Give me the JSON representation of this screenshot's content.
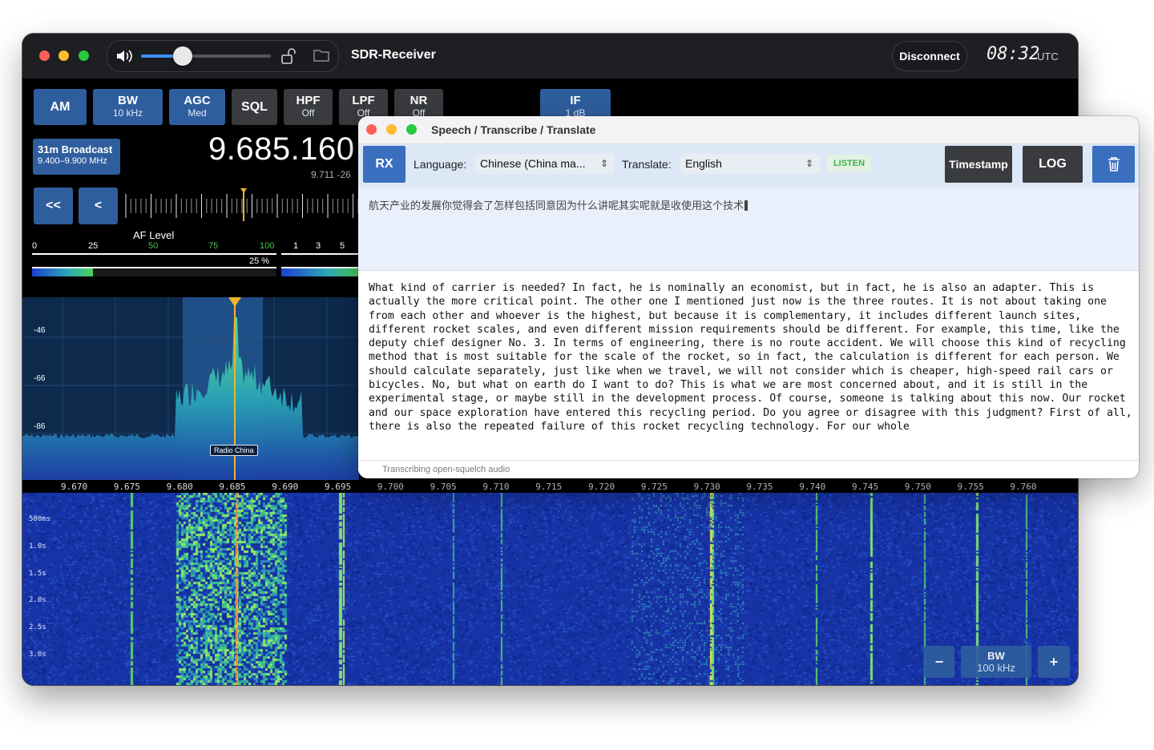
{
  "main_window": {
    "title": "SDR-Receiver",
    "disconnect_label": "Disconnect",
    "time": "08:32",
    "time_zone": "UTC",
    "volume_level": 0.32
  },
  "controls": {
    "am": "AM",
    "bw": {
      "label": "BW",
      "value": "10 kHz"
    },
    "agc": {
      "label": "AGC",
      "value": "Med"
    },
    "sql": "SQL",
    "hpf": {
      "label": "HPF",
      "value": "Off"
    },
    "lpf": {
      "label": "LPF",
      "value": "Off"
    },
    "nr": {
      "label": "NR",
      "value": "Off"
    },
    "if": {
      "label": "IF",
      "value": "1 dB"
    }
  },
  "band": {
    "name": "31m Broadcast",
    "range": "9.400–9.900 MHz"
  },
  "frequency": {
    "main": "9.685.160",
    "sub": "9.711 -26"
  },
  "tuning": {
    "fast_back": "<<",
    "back": "<"
  },
  "af": {
    "label": "AF Level",
    "ticks": [
      "0",
      "25",
      "50",
      "75",
      "100"
    ],
    "value_text": "25 %",
    "level": 0.25
  },
  "second_meter": {
    "ticks": [
      "1",
      "3",
      "5"
    ]
  },
  "spectrum": {
    "db_labels": [
      "-46",
      "-66",
      "-86"
    ],
    "station_label": "Radio China"
  },
  "freq_axis": [
    "9.670",
    "9.675",
    "9.680",
    "9.685",
    "9.690",
    "9.695",
    "9.700",
    "9.705",
    "9.710",
    "9.715",
    "9.720",
    "9.725",
    "9.730",
    "9.735",
    "9.740",
    "9.745",
    "9.750",
    "9.755",
    "9.760"
  ],
  "waterfall": {
    "time_labels": [
      "500ms",
      "1.0s",
      "1.5s",
      "2.0s",
      "2.5s",
      "3.0s"
    ],
    "zoom_out": "−",
    "zoom_in": "+",
    "bw_label": "BW",
    "bw_value": "100 kHz"
  },
  "speech_window": {
    "title": "Speech / Transcribe / Translate",
    "rx": "RX",
    "language_label": "Language:",
    "language_value": "Chinese (China ma...",
    "translate_label": "Translate:",
    "translate_value": "English",
    "listen_badge": "LISTEN",
    "timestamp_button": "Timestamp",
    "log_button": "LOG",
    "original_text": "航天产业的发展你觉得会了怎样包括同意因为什么讲呢其实呢就是收使用这个技术",
    "translation_text": "What kind of carrier is needed? In fact, he is nominally an economist, but in fact, he is also an adapter. This is actually the more critical point. The other one I mentioned just now is the three routes. It is not about taking one from each other and whoever is the highest, but because it is complementary, it includes different launch sites, different rocket scales, and even different mission requirements should be different. For example, this time, like the deputy chief designer No. 3. In terms of engineering, there is no route accident. We will choose this kind of recycling method that is most suitable for the scale of the rocket, so in fact, the calculation is different for each person. We should calculate separately, just like when we travel, we will not consider which is cheaper, high-speed rail cars or bicycles. No, but what on earth do I want to do? This is what we are most concerned about, and it is still in the experimental stage, or maybe still in the development process. Of course, someone is talking about this now. Our rocket and our space exploration have entered this recycling period. Do you agree or disagree with this judgment? First of all, there is also the repeated failure of this rocket recycling technology. For our whole",
    "status": "Transcribing open-squelch audio"
  },
  "colors": {
    "button_blue": "#2f5e9e",
    "tuning_marker": "#f0b429",
    "listen_green": "#39b54a",
    "trash_blue": "#3a6fc0"
  }
}
